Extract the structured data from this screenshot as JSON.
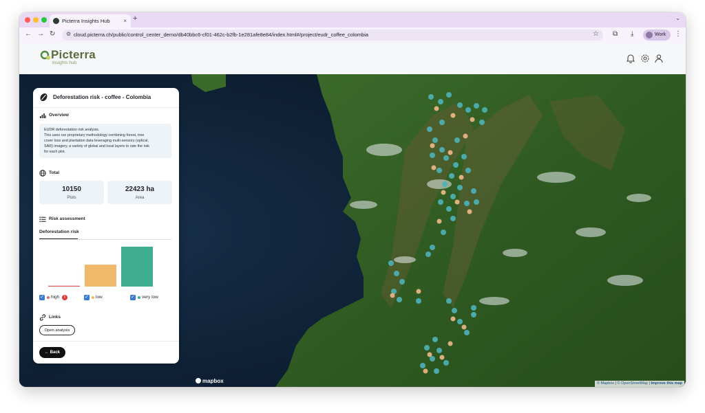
{
  "browser": {
    "tab_title": "Picterra Insights Hub",
    "tab_close": "×",
    "new_tab": "+",
    "tab_menu": "⌄",
    "url": "cloud.picterra.ch/public/control_center_demo/db40bbc6-cf01-462c-b2fb-1e281afe8e84/index.html#/project/eudr_coffee_colombia",
    "profile_label": "Work"
  },
  "app": {
    "logo_text": "Picterra",
    "logo_subtext": "Insights hub"
  },
  "panel": {
    "title": "Deforestation risk - coffee - Colombia",
    "overview": {
      "heading": "Overview",
      "lines": [
        "EUDR deforestation risk analysis.",
        "This uses our proprietary methodology combining forest, tree",
        "cover loss and plantation data leveraging multi-sensors (optical,",
        "SAR) imagery, a variety of global and local layers to rate the risk",
        "for each plot."
      ]
    },
    "total": {
      "heading": "Total",
      "plots_value": "10150",
      "plots_label": "Plots",
      "area_value": "22423 ha",
      "area_label": "Area"
    },
    "risk": {
      "heading": "Risk assessment",
      "tab_label": "Deforestation risk"
    },
    "links": {
      "heading": "Links",
      "open_analysis": "Open analysis"
    },
    "back_label": "Back"
  },
  "chart_data": {
    "type": "bar",
    "categories": [
      "high",
      "low",
      "very low"
    ],
    "values": [
      0.02,
      0.55,
      1.0
    ],
    "colors": [
      "#d9534f",
      "#f0b86a",
      "#3fae90"
    ],
    "legend_placement": "bottom",
    "grid": false,
    "legend": [
      {
        "label": "high",
        "color": "#e06c6c",
        "checked": true,
        "warning": "!"
      },
      {
        "label": "low",
        "color": "#f0b86a",
        "checked": true
      },
      {
        "label": "very low",
        "color": "#3fae90",
        "checked": true
      }
    ]
  },
  "map": {
    "attribution_mapbox": "© Mapbox",
    "attribution_osm": "© OpenStreetMap",
    "attribution_improve": "Improve this map",
    "mapbox_logo": "mapbox"
  },
  "colors": {
    "accent": "#3fae90",
    "low": "#f0b86a",
    "high": "#d9534f",
    "browser_chrome": "#e9d9f4"
  }
}
